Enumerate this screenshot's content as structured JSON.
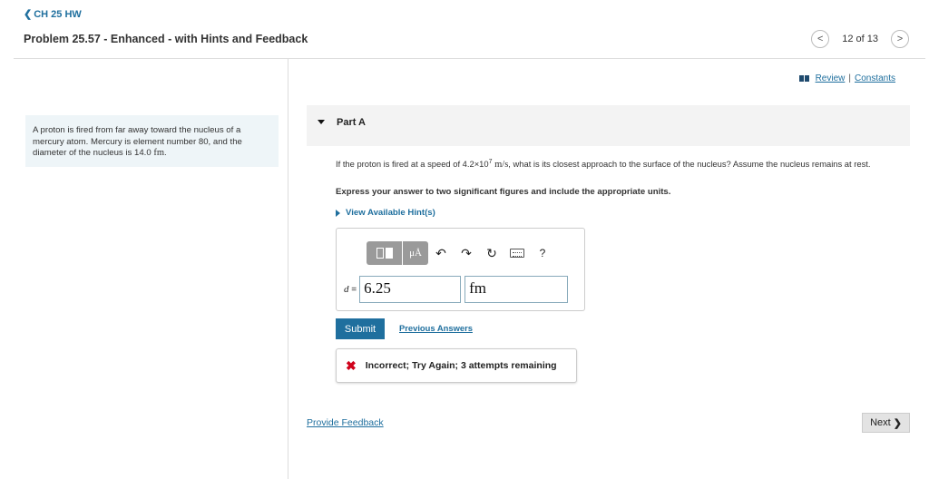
{
  "header": {
    "back_label": "CH 25 HW",
    "problem_title": "Problem 25.57 - Enhanced - with Hints and Feedback",
    "pager_text": "12 of 13"
  },
  "context": {
    "text_before": "A proton is fired from far away toward the nucleus of a mercury atom. Mercury is element number 80, and the diameter of the nucleus is 14.0 ",
    "unit": "fm",
    "text_after": "."
  },
  "links": {
    "review": "Review",
    "separator": "|",
    "constants": "Constants"
  },
  "part": {
    "label": "Part A"
  },
  "question": {
    "text_before": "If the proton is fired at a speed of 4.2×10",
    "exponent": "7",
    "unit": "m/s",
    "text_after": ", what is its closest approach to the surface of the nucleus? Assume the nucleus remains at rest.",
    "instruction": "Express your answer to two significant figures and include the appropriate units.",
    "hints_label": "View Available Hint(s)"
  },
  "answer": {
    "variable": "d",
    "equals": "=",
    "value": "6.25",
    "unit": "fm",
    "toolbar_mu": "μÅ",
    "help": "?"
  },
  "actions": {
    "submit": "Submit",
    "previous_answers": "Previous Answers"
  },
  "feedback": {
    "icon": "✖",
    "text": "Incorrect; Try Again; 3 attempts remaining"
  },
  "footer": {
    "provide_feedback": "Provide Feedback",
    "next": "Next"
  },
  "colors": {
    "accent": "#1f6f9e",
    "error": "#d0021b",
    "context_bg": "#eef5f8"
  }
}
